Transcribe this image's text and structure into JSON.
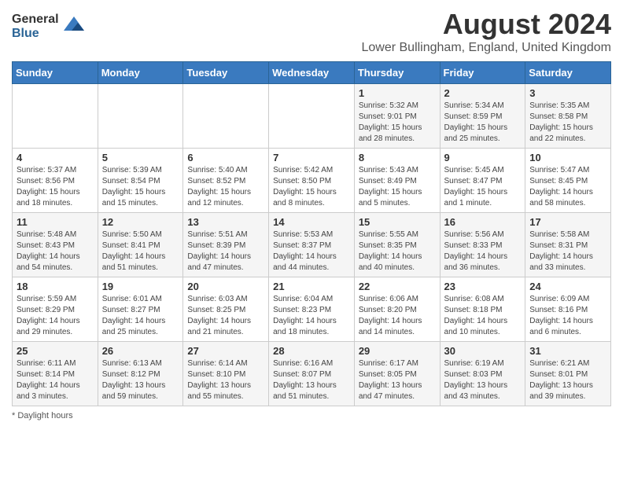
{
  "logo": {
    "general": "General",
    "blue": "Blue"
  },
  "header": {
    "month_year": "August 2024",
    "location": "Lower Bullingham, England, United Kingdom"
  },
  "days_of_week": [
    "Sunday",
    "Monday",
    "Tuesday",
    "Wednesday",
    "Thursday",
    "Friday",
    "Saturday"
  ],
  "weeks": [
    [
      {
        "day": "",
        "info": ""
      },
      {
        "day": "",
        "info": ""
      },
      {
        "day": "",
        "info": ""
      },
      {
        "day": "",
        "info": ""
      },
      {
        "day": "1",
        "info": "Sunrise: 5:32 AM\nSunset: 9:01 PM\nDaylight: 15 hours and 28 minutes."
      },
      {
        "day": "2",
        "info": "Sunrise: 5:34 AM\nSunset: 8:59 PM\nDaylight: 15 hours and 25 minutes."
      },
      {
        "day": "3",
        "info": "Sunrise: 5:35 AM\nSunset: 8:58 PM\nDaylight: 15 hours and 22 minutes."
      }
    ],
    [
      {
        "day": "4",
        "info": "Sunrise: 5:37 AM\nSunset: 8:56 PM\nDaylight: 15 hours and 18 minutes."
      },
      {
        "day": "5",
        "info": "Sunrise: 5:39 AM\nSunset: 8:54 PM\nDaylight: 15 hours and 15 minutes."
      },
      {
        "day": "6",
        "info": "Sunrise: 5:40 AM\nSunset: 8:52 PM\nDaylight: 15 hours and 12 minutes."
      },
      {
        "day": "7",
        "info": "Sunrise: 5:42 AM\nSunset: 8:50 PM\nDaylight: 15 hours and 8 minutes."
      },
      {
        "day": "8",
        "info": "Sunrise: 5:43 AM\nSunset: 8:49 PM\nDaylight: 15 hours and 5 minutes."
      },
      {
        "day": "9",
        "info": "Sunrise: 5:45 AM\nSunset: 8:47 PM\nDaylight: 15 hours and 1 minute."
      },
      {
        "day": "10",
        "info": "Sunrise: 5:47 AM\nSunset: 8:45 PM\nDaylight: 14 hours and 58 minutes."
      }
    ],
    [
      {
        "day": "11",
        "info": "Sunrise: 5:48 AM\nSunset: 8:43 PM\nDaylight: 14 hours and 54 minutes."
      },
      {
        "day": "12",
        "info": "Sunrise: 5:50 AM\nSunset: 8:41 PM\nDaylight: 14 hours and 51 minutes."
      },
      {
        "day": "13",
        "info": "Sunrise: 5:51 AM\nSunset: 8:39 PM\nDaylight: 14 hours and 47 minutes."
      },
      {
        "day": "14",
        "info": "Sunrise: 5:53 AM\nSunset: 8:37 PM\nDaylight: 14 hours and 44 minutes."
      },
      {
        "day": "15",
        "info": "Sunrise: 5:55 AM\nSunset: 8:35 PM\nDaylight: 14 hours and 40 minutes."
      },
      {
        "day": "16",
        "info": "Sunrise: 5:56 AM\nSunset: 8:33 PM\nDaylight: 14 hours and 36 minutes."
      },
      {
        "day": "17",
        "info": "Sunrise: 5:58 AM\nSunset: 8:31 PM\nDaylight: 14 hours and 33 minutes."
      }
    ],
    [
      {
        "day": "18",
        "info": "Sunrise: 5:59 AM\nSunset: 8:29 PM\nDaylight: 14 hours and 29 minutes."
      },
      {
        "day": "19",
        "info": "Sunrise: 6:01 AM\nSunset: 8:27 PM\nDaylight: 14 hours and 25 minutes."
      },
      {
        "day": "20",
        "info": "Sunrise: 6:03 AM\nSunset: 8:25 PM\nDaylight: 14 hours and 21 minutes."
      },
      {
        "day": "21",
        "info": "Sunrise: 6:04 AM\nSunset: 8:23 PM\nDaylight: 14 hours and 18 minutes."
      },
      {
        "day": "22",
        "info": "Sunrise: 6:06 AM\nSunset: 8:20 PM\nDaylight: 14 hours and 14 minutes."
      },
      {
        "day": "23",
        "info": "Sunrise: 6:08 AM\nSunset: 8:18 PM\nDaylight: 14 hours and 10 minutes."
      },
      {
        "day": "24",
        "info": "Sunrise: 6:09 AM\nSunset: 8:16 PM\nDaylight: 14 hours and 6 minutes."
      }
    ],
    [
      {
        "day": "25",
        "info": "Sunrise: 6:11 AM\nSunset: 8:14 PM\nDaylight: 14 hours and 3 minutes."
      },
      {
        "day": "26",
        "info": "Sunrise: 6:13 AM\nSunset: 8:12 PM\nDaylight: 13 hours and 59 minutes."
      },
      {
        "day": "27",
        "info": "Sunrise: 6:14 AM\nSunset: 8:10 PM\nDaylight: 13 hours and 55 minutes."
      },
      {
        "day": "28",
        "info": "Sunrise: 6:16 AM\nSunset: 8:07 PM\nDaylight: 13 hours and 51 minutes."
      },
      {
        "day": "29",
        "info": "Sunrise: 6:17 AM\nSunset: 8:05 PM\nDaylight: 13 hours and 47 minutes."
      },
      {
        "day": "30",
        "info": "Sunrise: 6:19 AM\nSunset: 8:03 PM\nDaylight: 13 hours and 43 minutes."
      },
      {
        "day": "31",
        "info": "Sunrise: 6:21 AM\nSunset: 8:01 PM\nDaylight: 13 hours and 39 minutes."
      }
    ]
  ],
  "footer": {
    "note": "Daylight hours"
  }
}
